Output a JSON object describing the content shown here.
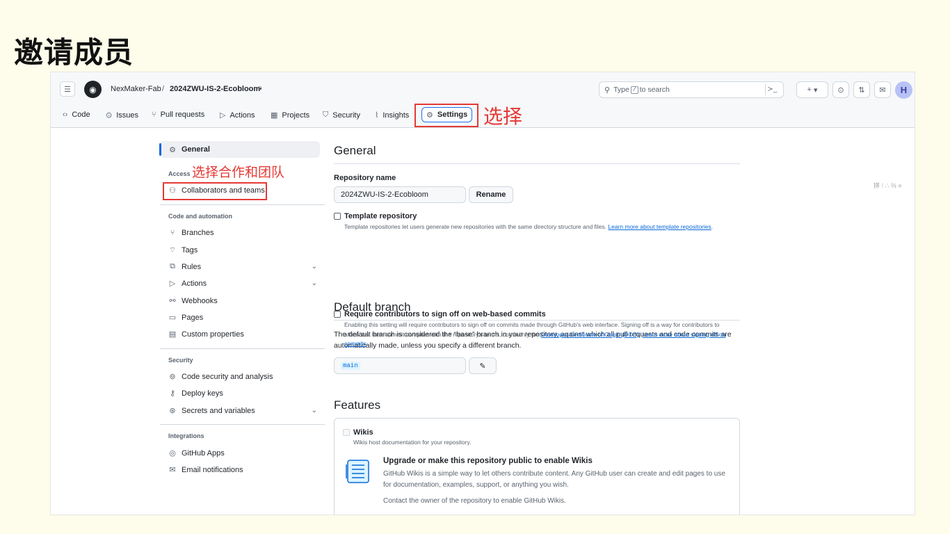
{
  "slide": {
    "title": "邀请成员"
  },
  "annotations": {
    "select_settings": "选择",
    "select_collaborators": "选择合作和团队",
    "accent_color": "#e53935"
  },
  "header": {
    "owner": "NexMaker-Fab",
    "separator": "/",
    "repo": "2024ZWU-IS-2-Ecobloom",
    "search": {
      "prefix": "Type",
      "key": "/",
      "suffix": "to search"
    },
    "command_palette": "≻_",
    "create_label": "+",
    "avatar_letter": "H"
  },
  "tabs": [
    {
      "label": "Code",
      "icon": "code-icon"
    },
    {
      "label": "Issues",
      "icon": "issue-icon"
    },
    {
      "label": "Pull requests",
      "icon": "pull-request-icon"
    },
    {
      "label": "Actions",
      "icon": "play-icon"
    },
    {
      "label": "Projects",
      "icon": "table-icon"
    },
    {
      "label": "Security",
      "icon": "shield-icon"
    },
    {
      "label": "Insights",
      "icon": "graph-icon"
    },
    {
      "label": "Settings",
      "icon": "gear-icon"
    }
  ],
  "sidebar": {
    "general": "General",
    "access_heading": "Access",
    "collaborators": "Collaborators and teams",
    "code_automation_heading": "Code and automation",
    "code_items": [
      "Branches",
      "Tags",
      "Rules",
      "Actions",
      "Webhooks",
      "Pages",
      "Custom properties"
    ],
    "security_heading": "Security",
    "security_items": [
      "Code security and analysis",
      "Deploy keys",
      "Secrets and variables"
    ],
    "integrations_heading": "Integrations",
    "integration_items": [
      "GitHub Apps",
      "Email notifications"
    ]
  },
  "main": {
    "general_title": "General",
    "repo_name_label": "Repository name",
    "repo_name_value": "2024ZWU-IS-2-Ecobloom",
    "rename_button": "Rename",
    "template_label": "Template repository",
    "template_note": "Template repositories let users generate new repositories with the same directory structure and files.",
    "template_link": "Learn more about template repositories",
    "signoff_label": "Require contributors to sign off on web-based commits",
    "signoff_note": "Enabling this setting will require contributors to sign off on commits made through GitHub's web interface. Signing off is a way for contributors to affirm that their commit complies with the repository's terms, commonly the",
    "signoff_link1": "Developer Certificate of Origin (DCO)",
    "signoff_link2": "Learn more about signing off on commits",
    "default_branch_title": "Default branch",
    "default_branch_desc": "The default branch is considered the “base” branch in your repository, against which all pull requests and code commits are automatically made, unless you specify a different branch.",
    "default_branch_value": "main",
    "features_title": "Features",
    "wikis_label": "Wikis",
    "wikis_note": "Wikis host documentation for your repository.",
    "upgrade_title": "Upgrade or make this repository public to enable Wikis",
    "upgrade_desc": "GitHub Wikis is a simple way to let others contribute content. Any GitHub user can create and edit pages to use for documentation, examples, support, or anything you wish.",
    "contact_owner": "Contact the owner of the repository to enable GitHub Wikis."
  },
  "ime_text": "拼 ⁝ ∴ ⅔ ⟡"
}
